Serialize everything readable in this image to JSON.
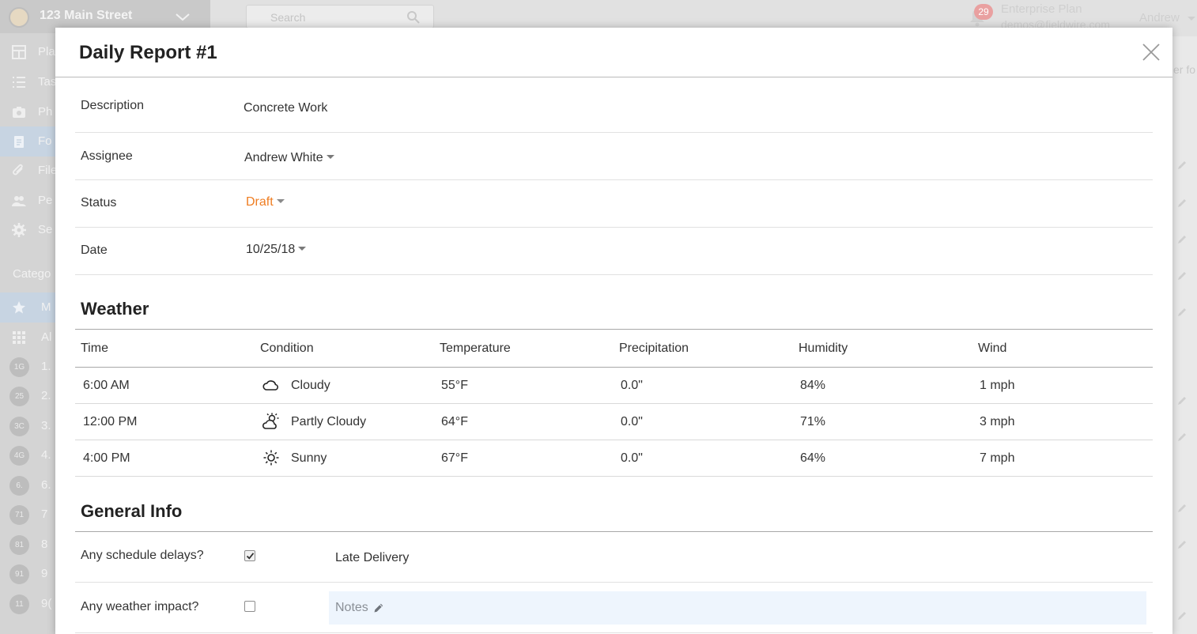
{
  "app": {
    "project_name": "123 Main Street",
    "nav": [
      {
        "label": "Pla"
      },
      {
        "label": "Tas"
      },
      {
        "label": "Ph"
      },
      {
        "label": "Fo"
      },
      {
        "label": "File"
      },
      {
        "label": "Pe"
      },
      {
        "label": "Se"
      }
    ],
    "categories_label": "Catego",
    "category_items": [
      {
        "badge": "",
        "label": "M"
      },
      {
        "badge": "",
        "label": "Al"
      },
      {
        "badge": "1G",
        "label": "1."
      },
      {
        "badge": "25",
        "label": "2."
      },
      {
        "badge": "3C",
        "label": "3."
      },
      {
        "badge": "4G",
        "label": "4."
      },
      {
        "badge": "6.",
        "label": "6."
      },
      {
        "badge": "71",
        "label": "7"
      },
      {
        "badge": "81",
        "label": "8"
      },
      {
        "badge": "91",
        "label": "9"
      },
      {
        "badge": "11",
        "label": "9("
      }
    ],
    "search_placeholder": "Search",
    "notification_count": "29",
    "plan_name": "Enterprise Plan",
    "user_email": "demos@fieldwire.com",
    "user_name": "Andrew",
    "right_peek": "er fo"
  },
  "report": {
    "title": "Daily Report #1",
    "fields": {
      "description": {
        "label": "Description",
        "value": "Concrete Work"
      },
      "assignee": {
        "label": "Assignee",
        "value": "Andrew White"
      },
      "status": {
        "label": "Status",
        "value": "Draft"
      },
      "date": {
        "label": "Date",
        "value": "10/25/18"
      }
    },
    "weather": {
      "title": "Weather",
      "columns": [
        "Time",
        "Condition",
        "Temperature",
        "Precipitation",
        "Humidity",
        "Wind"
      ],
      "rows": [
        {
          "time": "6:00 AM",
          "condition": "Cloudy",
          "icon": "cloud-icon",
          "temperature": "55°F",
          "precipitation": "0.0\"",
          "humidity": "84%",
          "wind": "1 mph"
        },
        {
          "time": "12:00 PM",
          "condition": "Partly Cloudy",
          "icon": "partly-cloudy-icon",
          "temperature": "64°F",
          "precipitation": "0.0\"",
          "humidity": "71%",
          "wind": "3 mph"
        },
        {
          "time": "4:00 PM",
          "condition": "Sunny",
          "icon": "sun-icon",
          "temperature": "67°F",
          "precipitation": "0.0\"",
          "humidity": "64%",
          "wind": "7 mph"
        }
      ]
    },
    "general_info": {
      "title": "General Info",
      "items": [
        {
          "question": "Any schedule delays?",
          "checked": true,
          "answer": "Late Delivery"
        },
        {
          "question": "Any weather impact?",
          "checked": false,
          "notes_placeholder": "Notes"
        }
      ]
    }
  },
  "colors": {
    "status_draft": "#ef7d22",
    "notes_bg": "#eef5fd",
    "overlay_sidebar": "#d4d4d4"
  }
}
